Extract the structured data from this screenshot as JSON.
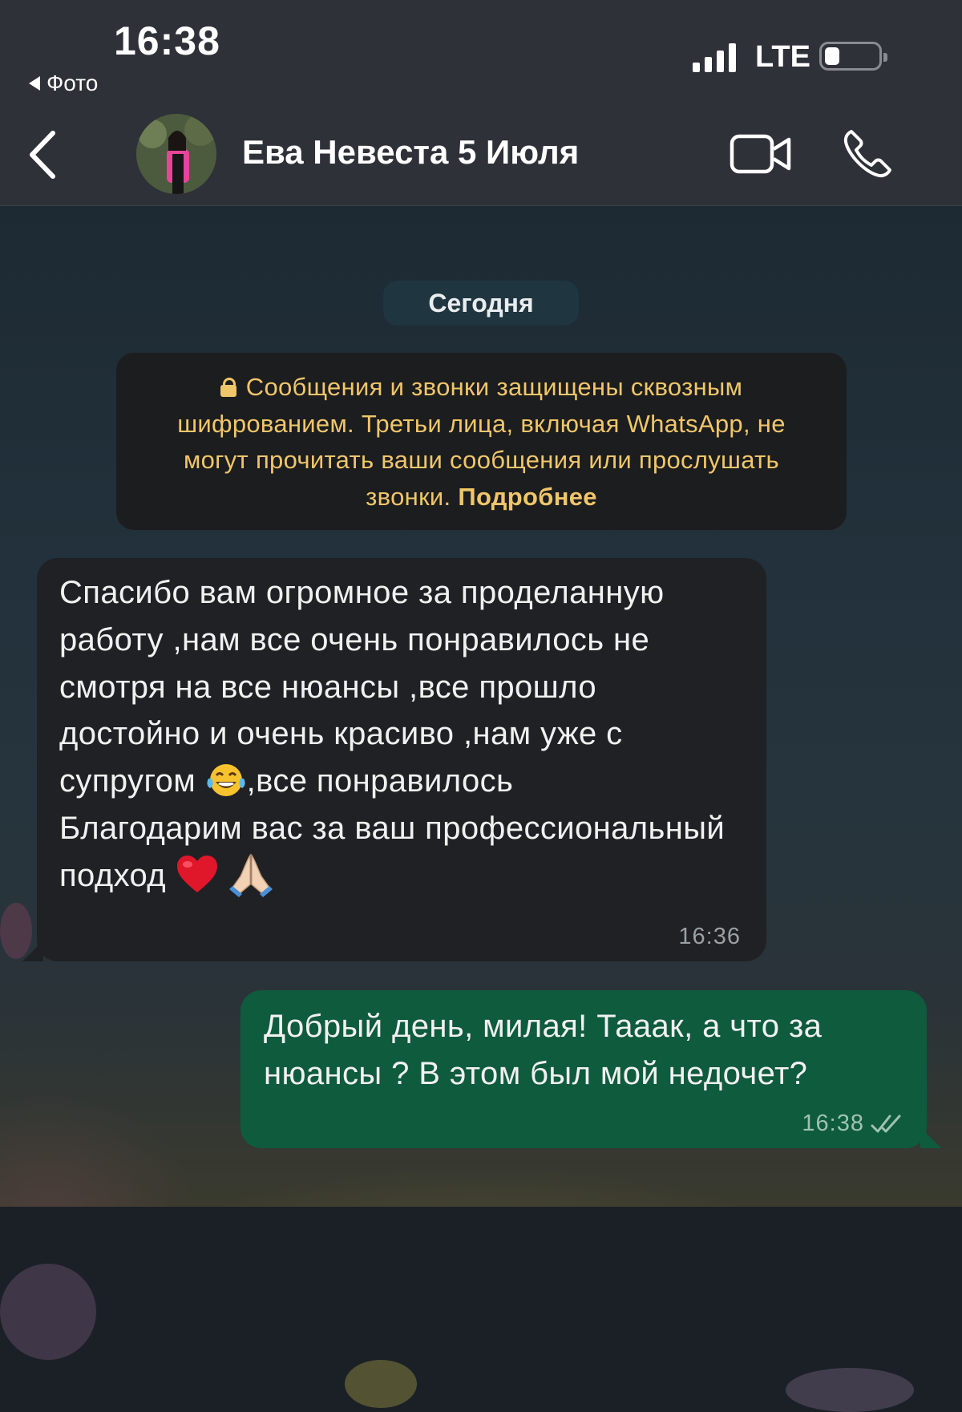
{
  "status_bar": {
    "time": "16:38",
    "back_app_label": "Фото",
    "network": "LTE",
    "signal_bars": 4,
    "battery_level_fraction": 0.2
  },
  "header": {
    "back_icon": "chevron-left-icon",
    "contact_name": "Ева Невеста 5 Июля",
    "video_icon": "video-camera-icon",
    "call_icon": "phone-icon"
  },
  "chat": {
    "date_separator": "Сегодня",
    "encryption_notice": {
      "icon": "lock-icon",
      "text": "Сообщения и звонки защищены сквозным шифрованием. Третьи лица, включая WhatsApp, не могут прочитать ваши сообщения или прослушать звонки.",
      "link": "Подробнее"
    },
    "messages": [
      {
        "direction": "incoming",
        "text_part1": "Спасибо вам огромное за проделанную работу ,нам все очень понравилось не смотря на все нюансы ,все прошло достойно и очень красиво ,нам уже с супругом",
        "emoji1": "face-with-tears-of-joy",
        "text_part2": ",все понравилось\nБлагодарим вас за ваш профессиональный подход",
        "emoji2": "red-heart",
        "emoji3": "folded-hands",
        "time": "16:36"
      },
      {
        "direction": "outgoing",
        "text": "Добрый день, милая! Тааак, а что за нюансы ?  В этом был мой недочет?",
        "time": "16:38",
        "read_status": "double-check-icon"
      }
    ]
  },
  "colors": {
    "header_bg": "#2e3138",
    "incoming_bubble": "#202124",
    "outgoing_bubble": "#0f5b3d",
    "notice_text": "#f0c66a"
  }
}
